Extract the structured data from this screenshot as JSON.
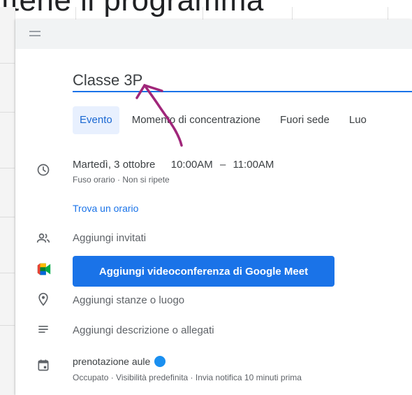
{
  "background_text": "ttene il programma",
  "dialog": {
    "title_input": {
      "value": "Classe 3P"
    },
    "tabs": [
      {
        "label": "Evento",
        "active": true
      },
      {
        "label": "Momento di concentrazione",
        "active": false
      },
      {
        "label": "Fuori sede",
        "active": false
      },
      {
        "label": "Luo",
        "active": false
      }
    ],
    "datetime": {
      "date": "Martedì, 3 ottobre",
      "start": "10:00AM",
      "dash": "–",
      "end": "11:00AM",
      "sub": "Fuso orario · Non si ripete"
    },
    "find_time": "Trova un orario",
    "add_guests": "Aggiungi invitati",
    "meet_button": "Aggiungi videoconferenza di Google Meet",
    "add_location": "Aggiungi stanze o luogo",
    "add_description": "Aggiungi descrizione o allegati",
    "calendar": {
      "name": "prenotazione aule",
      "color": "#1a8ff0",
      "details": "Occupato · Visibilità predefinita · Invia notifica 10 minuti prima"
    }
  },
  "colors": {
    "accent": "#1a73e8",
    "annotation_arrow": "#a0267a"
  },
  "icons": [
    "menu-handle-icon",
    "clock-icon",
    "people-icon",
    "google-meet-icon",
    "location-pin-icon",
    "description-lines-icon",
    "calendar-icon"
  ]
}
